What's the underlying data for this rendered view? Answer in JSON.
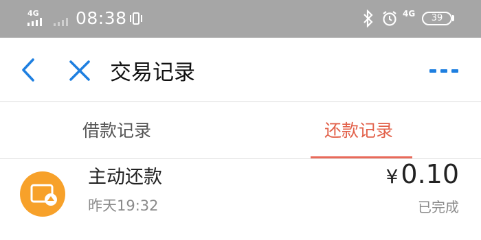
{
  "status_bar": {
    "network_left": "4G",
    "time": "08:38",
    "network_right": "4G",
    "battery": "39"
  },
  "header": {
    "title": "交易记录"
  },
  "tabs": [
    {
      "label": "借款记录",
      "active": false
    },
    {
      "label": "还款记录",
      "active": true
    }
  ],
  "records": [
    {
      "title": "主动还款",
      "time": "昨天19:32",
      "currency": "¥",
      "amount": "0.10",
      "status": "已完成",
      "icon": "wallet-upload-icon"
    }
  ],
  "colors": {
    "status_bar_bg": "#a6a6a6",
    "nav_blue": "#1e7fe0",
    "tab_active": "#e2614a",
    "icon_orange": "#f7a12a"
  }
}
